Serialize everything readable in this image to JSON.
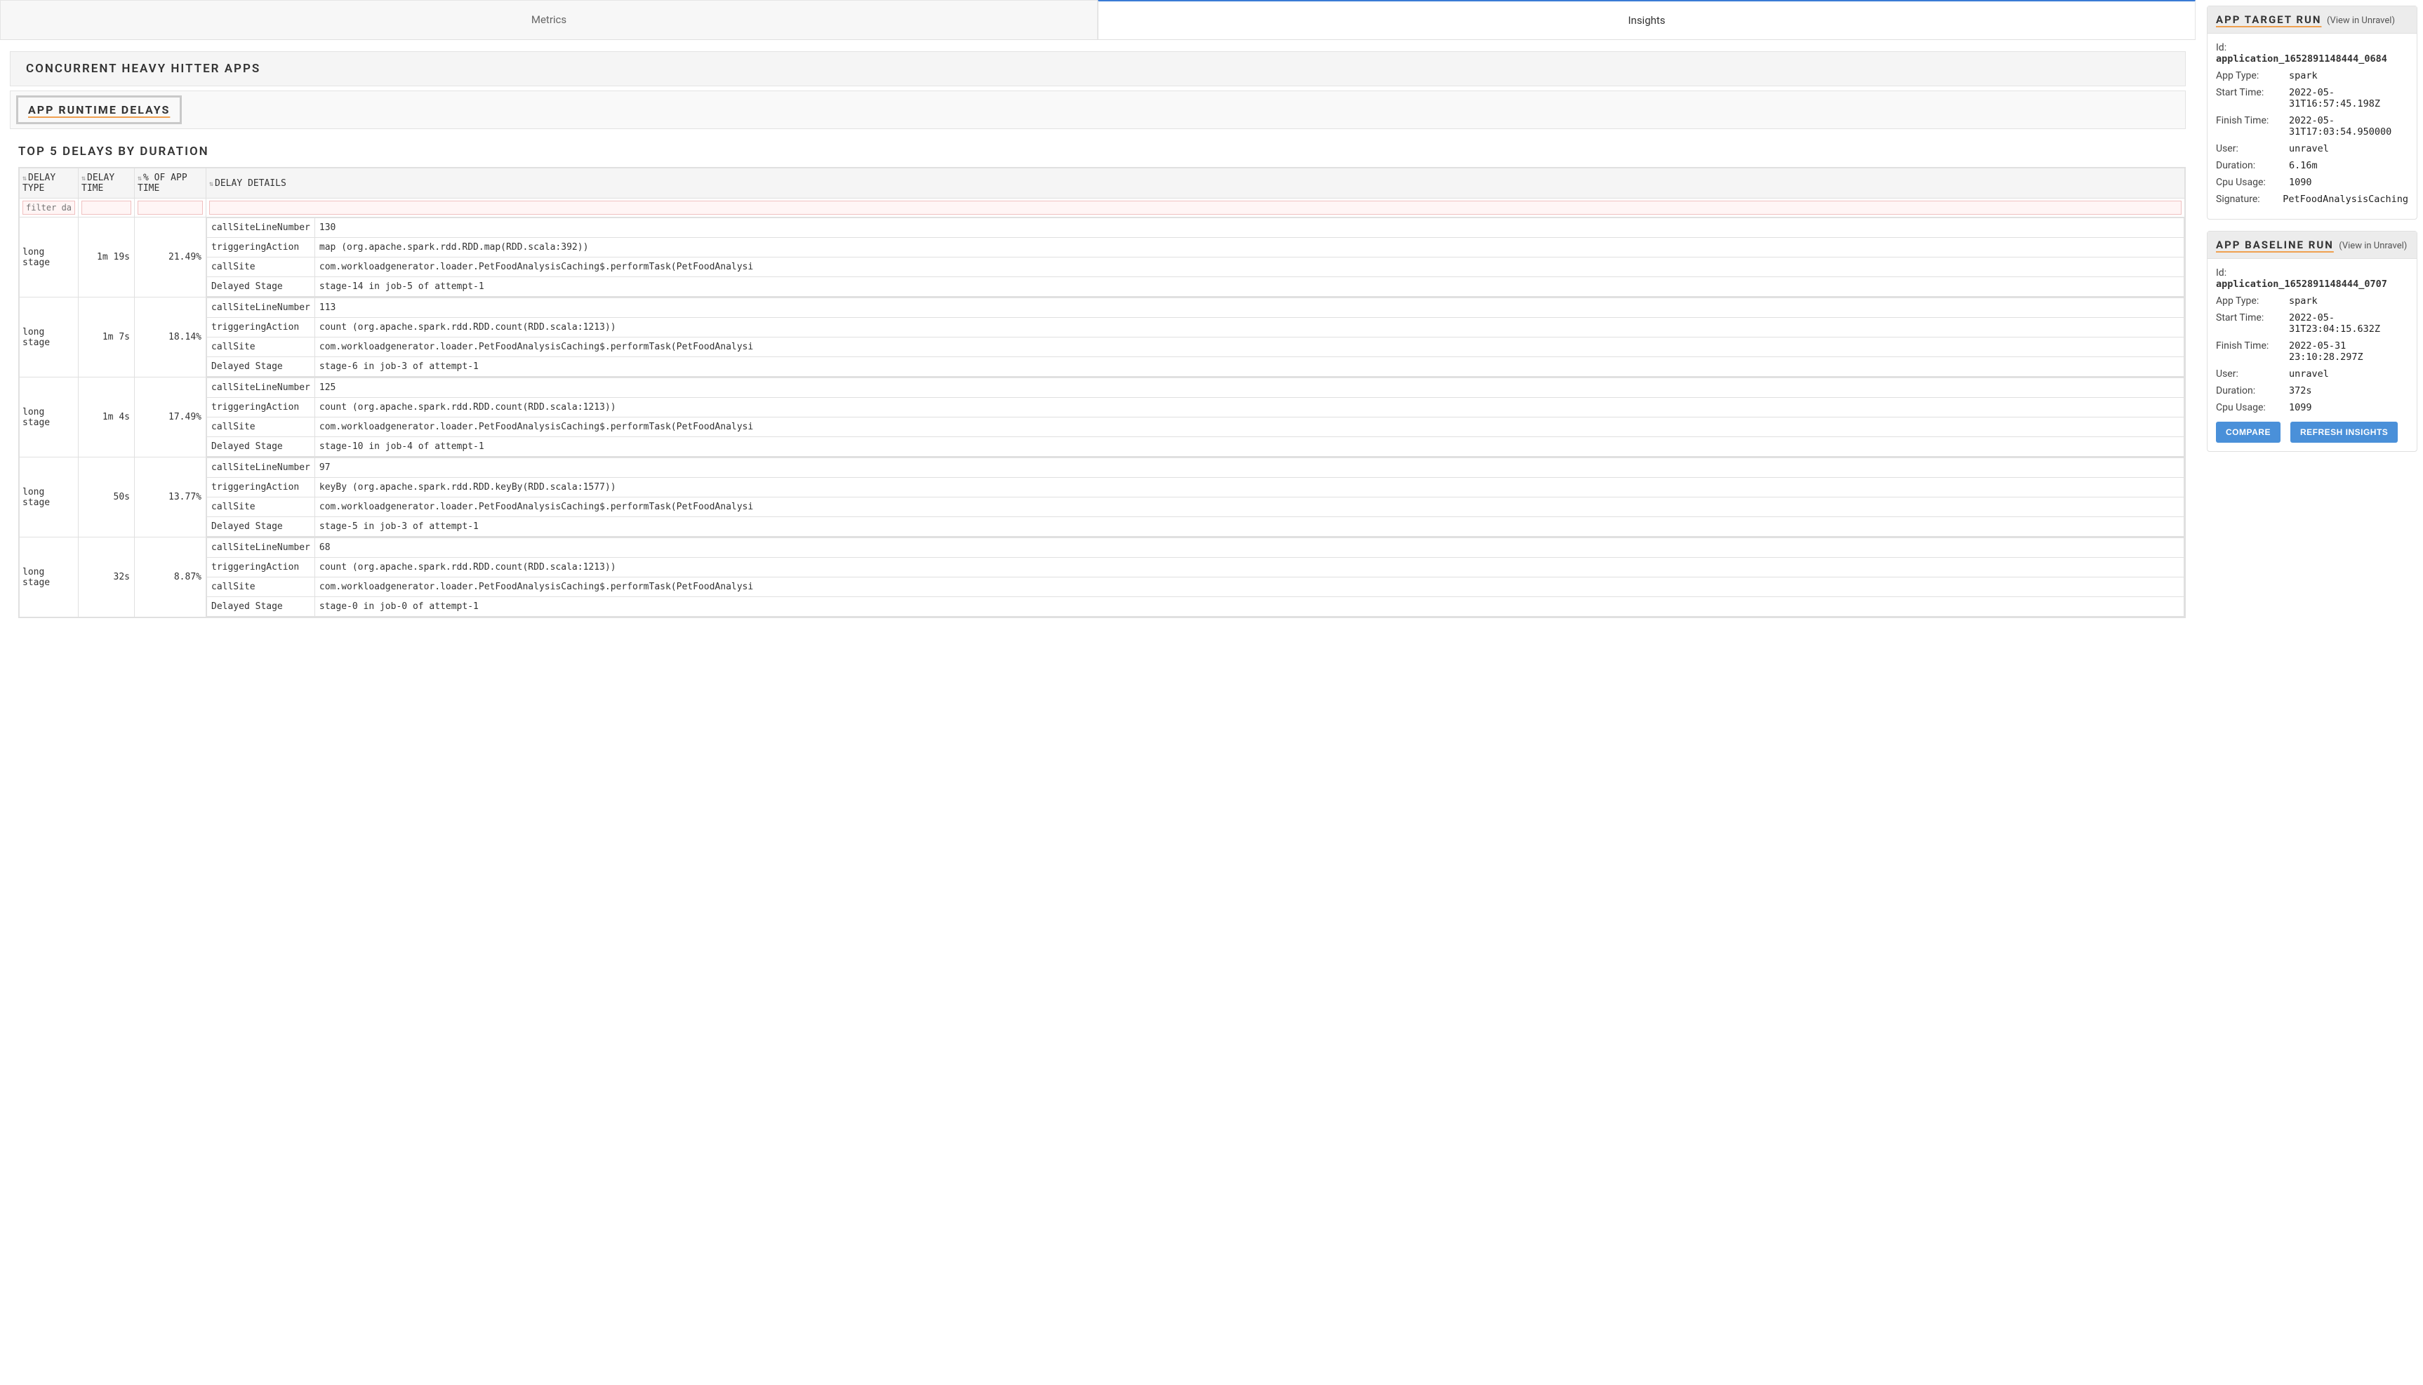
{
  "tabs": {
    "metrics": "Metrics",
    "insights": "Insights"
  },
  "section": {
    "heavy": "CONCURRENT HEAVY HITTER APPS",
    "delays_link": "APP RUNTIME DELAYS",
    "top5": "TOP 5 DELAYS BY DURATION"
  },
  "table": {
    "headers": {
      "type": "DELAY TYPE",
      "time": "DELAY TIME",
      "pct": "% OF APP TIME",
      "details": "DELAY DETAILS"
    },
    "filter_placeholder": "filter data",
    "detail_keys": {
      "csln": "callSiteLineNumber",
      "ta": "triggeringAction",
      "cs": "callSite",
      "ds": "Delayed Stage"
    },
    "rows": [
      {
        "type": "long stage",
        "time": "1m 19s",
        "pct": "21.49%",
        "csln": "130",
        "ta": "map (org.apache.spark.rdd.RDD.map(RDD.scala:392))",
        "cs": "com.workloadgenerator.loader.PetFoodAnalysisCaching$.performTask(PetFoodAnalysi",
        "ds": "stage-14 in job-5 of attempt-1"
      },
      {
        "type": "long stage",
        "time": "1m 7s",
        "pct": "18.14%",
        "csln": "113",
        "ta": "count (org.apache.spark.rdd.RDD.count(RDD.scala:1213))",
        "cs": "com.workloadgenerator.loader.PetFoodAnalysisCaching$.performTask(PetFoodAnalysi",
        "ds": "stage-6 in job-3 of attempt-1"
      },
      {
        "type": "long stage",
        "time": "1m 4s",
        "pct": "17.49%",
        "csln": "125",
        "ta": "count (org.apache.spark.rdd.RDD.count(RDD.scala:1213))",
        "cs": "com.workloadgenerator.loader.PetFoodAnalysisCaching$.performTask(PetFoodAnalysi",
        "ds": "stage-10 in job-4 of attempt-1"
      },
      {
        "type": "long stage",
        "time": "50s",
        "pct": "13.77%",
        "csln": "97",
        "ta": "keyBy (org.apache.spark.rdd.RDD.keyBy(RDD.scala:1577))",
        "cs": "com.workloadgenerator.loader.PetFoodAnalysisCaching$.performTask(PetFoodAnalysi",
        "ds": "stage-5 in job-3 of attempt-1"
      },
      {
        "type": "long stage",
        "time": "32s",
        "pct": "8.87%",
        "csln": "68",
        "ta": "count (org.apache.spark.rdd.RDD.count(RDD.scala:1213))",
        "cs": "com.workloadgenerator.loader.PetFoodAnalysisCaching$.performTask(PetFoodAnalysi",
        "ds": "stage-0 in job-0 of attempt-1"
      }
    ]
  },
  "target_run": {
    "title": "APP TARGET RUN",
    "view": "(View in Unravel)",
    "id_label": "Id:",
    "id": "application_1652891148444_0684",
    "fields": [
      {
        "k": "App Type:",
        "v": "spark"
      },
      {
        "k": "Start Time:",
        "v": "2022-05-31T16:57:45.198Z"
      },
      {
        "k": "Finish Time:",
        "v": "2022-05-31T17:03:54.950000"
      },
      {
        "k": "User:",
        "v": "unravel"
      },
      {
        "k": "Duration:",
        "v": "6.16m"
      },
      {
        "k": "Cpu Usage:",
        "v": "1090"
      },
      {
        "k": "Signature:",
        "v": "PetFoodAnalysisCaching"
      }
    ]
  },
  "baseline_run": {
    "title": "APP BASELINE RUN",
    "view": "(View in Unravel)",
    "id_label": "Id:",
    "id": "application_1652891148444_0707",
    "fields": [
      {
        "k": "App Type:",
        "v": "spark"
      },
      {
        "k": "Start Time:",
        "v": "2022-05-31T23:04:15.632Z"
      },
      {
        "k": "Finish Time:",
        "v": "2022-05-31 23:10:28.297Z"
      },
      {
        "k": "User:",
        "v": "unravel"
      },
      {
        "k": "Duration:",
        "v": "372s"
      },
      {
        "k": "Cpu Usage:",
        "v": "1099"
      }
    ],
    "compare_btn": "COMPARE",
    "refresh_btn": "REFRESH INSIGHTS"
  }
}
